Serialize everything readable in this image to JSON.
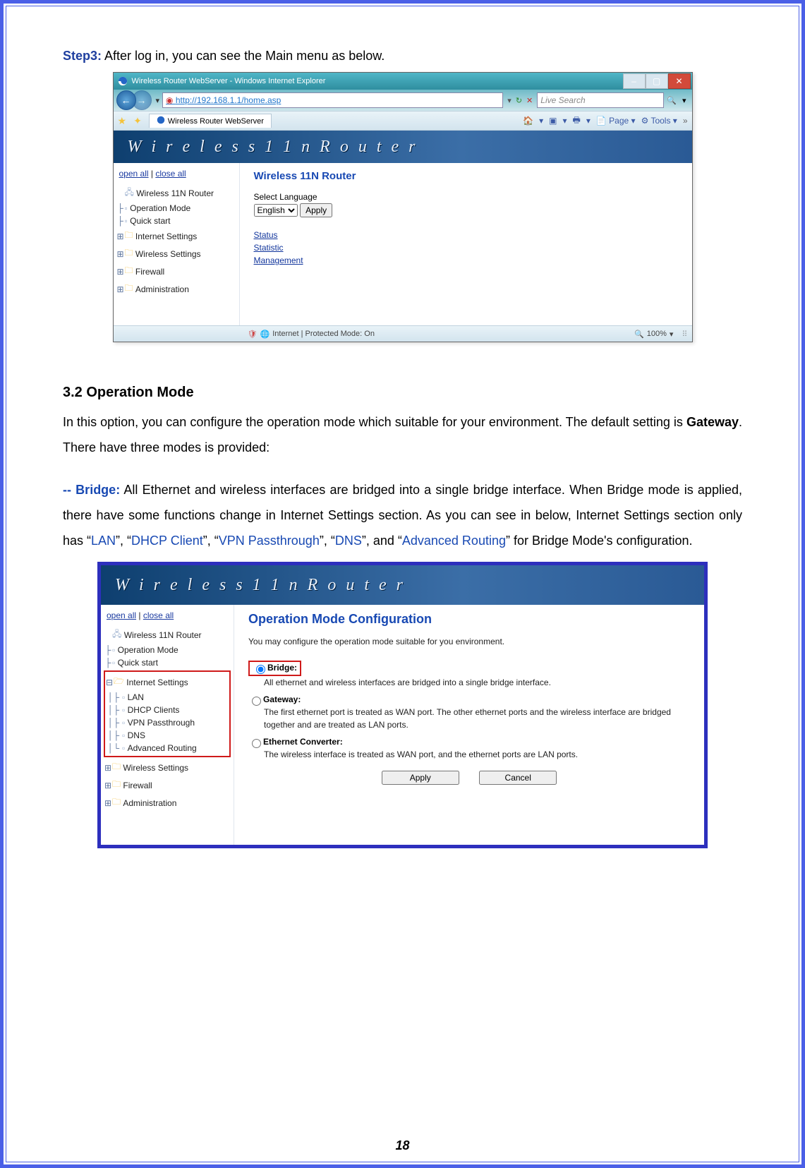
{
  "step3": {
    "label": "Step3:",
    "text": " After log in, you can see the Main menu as below."
  },
  "ss1": {
    "title": "Wireless Router WebServer - Windows Internet Explorer",
    "url": "http://192.168.1.1/home.asp",
    "search_placeholder": "Live Search",
    "tab_title": "Wireless Router WebServer",
    "toolbar": {
      "page": "Page",
      "tools": "Tools"
    },
    "banner_text": "W i r e l e s s   1 1 n   R o u t e r",
    "tree_links": {
      "open": "open all",
      "close": "close all"
    },
    "tree": {
      "root": "Wireless 11N Router",
      "op_mode": "Operation Mode",
      "quick": "Quick start",
      "internet": "Internet Settings",
      "wireless": "Wireless Settings",
      "firewall": "Firewall",
      "admin": "Administration"
    },
    "main": {
      "heading": "Wireless 11N Router",
      "lang_label": "Select Language",
      "lang_value": "English",
      "apply": "Apply",
      "links": {
        "status": "Status",
        "statistic": "Statistic",
        "mgmt": "Management"
      }
    },
    "status": {
      "mode": "Internet | Protected Mode: On",
      "zoom": "100%"
    }
  },
  "section": {
    "heading": "3.2    Operation Mode",
    "p1a": "In this option, you can configure the operation mode which suitable for your environment. The default setting is ",
    "p1b": "Gateway",
    "p1c": ". There have three modes is provided:",
    "bridge_label": "-- Bridge:",
    "p2a": " All Ethernet and wireless interfaces are bridged into a single bridge interface. When Bridge mode is applied, there have some functions change in Internet Settings section. As you can see in below, Internet Settings section only has “",
    "l1": "LAN",
    "p2b": "”, “",
    "l2": "DHCP Client",
    "p2c": "”, “",
    "l3": "VPN Passthrough",
    "p2d": "”, “",
    "l4": "DNS",
    "p2e": "”, and “",
    "l5": "Advanced Routing",
    "p2f": "” for Bridge Mode's configuration."
  },
  "ss2": {
    "banner_text": "W i r e l e s s   1 1 n   R o u t e r",
    "tree_links": {
      "open": "open all",
      "close": "close all"
    },
    "tree": {
      "root": "Wireless 11N Router",
      "op_mode": "Operation Mode",
      "quick": "Quick start",
      "internet": "Internet Settings",
      "lan": "LAN",
      "dhcp": "DHCP Clients",
      "vpn": "VPN Passthrough",
      "dns": "DNS",
      "adv": "Advanced Routing",
      "wireless": "Wireless Settings",
      "firewall": "Firewall",
      "admin": "Administration"
    },
    "main": {
      "heading": "Operation Mode Configuration",
      "desc": "You may configure the operation mode suitable for you environment.",
      "bridge_label": "Bridge:",
      "bridge_desc": "All ethernet and wireless interfaces are bridged into a single bridge interface.",
      "gateway_label": "Gateway:",
      "gateway_desc": "The first ethernet port is treated as WAN port. The other ethernet ports and the wireless interface are bridged together and are treated as LAN ports.",
      "eth_label": "Ethernet Converter:",
      "eth_desc": "The wireless interface is treated as WAN port, and the ethernet ports are LAN ports.",
      "apply": "Apply",
      "cancel": "Cancel"
    }
  },
  "pagenum": "18"
}
